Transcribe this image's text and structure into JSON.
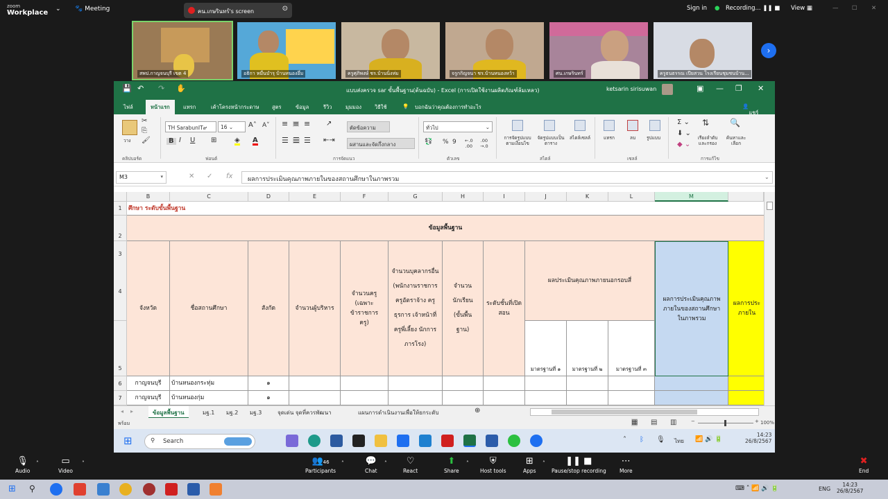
{
  "zoom": {
    "brand_small": "zoom",
    "brand": "Workplace",
    "meeting": "Meeting",
    "share_label": "คน.เกษรินทร์'s screen",
    "sign_in": "Sign in",
    "recording": "Recording...",
    "view": "View"
  },
  "participants": [
    "สพป.กาญจนบุรี เขต 4",
    "อธิกา หมื่นบำรุ บ้านหนองอึ่ม",
    "ครูศุภิพงษ์ ชร.บ้านนิ่งห่ม",
    "จรูกกิญจนา ชร.บ้านหนองหว้า",
    "ศน.เกษรินทร์",
    "ครูธนธรรณ เปียสวน โรงเรียนชุมชนบ้าน..."
  ],
  "excel": {
    "title": "แบบส่งครวจ sar ขั้นพื้นฐาน(ต้นฉบับ) - Excel (การเปิดใช้งานผลิตภัณฑ์ล้มเหลว)",
    "user": "ketsarin sirisuwan",
    "tabs": [
      "ไฟล์",
      "หน้าแรก",
      "แทรก",
      "เค้าโครงหน้ากระดาษ",
      "สูตร",
      "ข้อมูล",
      "รีวิว",
      "มุมมอง",
      "วิธีใช้",
      "บอกฉันว่าคุณต้องการทำอะไร"
    ],
    "share_btn": "แชร์",
    "ribbon": {
      "font": "TH SarabunIT๙",
      "size": "16",
      "format": "ทั่วไป",
      "wrap": "ตัดข้อความ",
      "merge": "ผสานและจัดกึ่งกลาง",
      "paste": "วาง",
      "g1": "คลิปบอร์ด",
      "g2": "ฟอนต์",
      "g3": "การจัดแนว",
      "g4": "ตัวเลข",
      "g5": "สไตล์",
      "g6": "เซลล์",
      "g7": "การแก้ไข",
      "cond": "การจัดรูปแบบตามเงื่อนไข",
      "astable": "จัดรูปแบบเป็นตาราง",
      "styles": "สไตล์เซลล์",
      "insert": "แทรก",
      "delete": "ลบ",
      "format2": "รูปแบบ",
      "sort": "เรียงลำดับและกรอง",
      "find": "ค้นหาและเลือก"
    },
    "namebox": "M3",
    "formula": "ผลการประเมินคุณภาพภายในของสถานศึกษาในภาพรวม",
    "cols": [
      "B",
      "C",
      "D",
      "E",
      "F",
      "G",
      "H",
      "I",
      "J",
      "K",
      "L",
      "M"
    ],
    "rows": [
      "1",
      "2",
      "3",
      "4",
      "5",
      "6",
      "7"
    ],
    "r1": "ศึกษา ระดับขั้นพื้นฐาน",
    "r2": "ข้อมูลพื้นฐาน",
    "h": {
      "b": "จังหวัด",
      "c": "ชื่อสถานศึกษา",
      "d": "สังกัด",
      "e": "จำนวนผู้บริหาร",
      "f": "จำนวนครู (เฉพาะข้าราชการครู)",
      "g": "จำนวนบุคลากรอื่น (พนักงานราชการ ครูอัตราจ้าง ครูธุรการ เจ้าหน้าที่ ครูพี่เลี้ยง นักการภารโรง)",
      "h2": "จำนวนนักเรียน (ขั้นพื้นฐาน)",
      "i": "ระดับชั้นที่เปิดสอน",
      "jl": "ผลประเมินคุณภาพภายนอกรอบสี่",
      "j5": "มาตรฐานที่ ๑",
      "k5": "มาตรฐานที่ ๒",
      "l5": "มาตรฐานที่ ๓",
      "m": "ผลการประเมินคุณภาพภายในของสถานศึกษาในภาพรวม",
      "n": "ผลการประ ภายใน"
    },
    "data": [
      {
        "b": "กาญจนบุรี",
        "c": "บ้านหนองกระทุ่ม",
        "d": "๑"
      },
      {
        "b": "กาญจนบุรี",
        "c": "บ้านหนองกุ่ม",
        "d": "๑"
      }
    ],
    "sheets": [
      "ข้อมูลพื้นฐาน",
      "มฐ.1",
      "มฐ.2",
      "มฐ.3",
      "จุดเด่น จุดที่ควรพัฒนา",
      "แผนการดำเนินงานเพื่อให้ยกระดับ"
    ],
    "status_left": "พร้อม",
    "zoom_pct": "100%",
    "search": "Search",
    "lang": "ไทย",
    "time": "14:23",
    "date": "26/8/2567"
  },
  "bottom": {
    "audio": "Audio",
    "video": "Video",
    "participants": "Participants",
    "count": "46",
    "chat": "Chat",
    "react": "React",
    "share": "Share",
    "host": "Host tools",
    "apps": "Apps",
    "rec": "Pause/stop recording",
    "more": "More",
    "end": "End"
  },
  "taskbar": {
    "lang": "ENG",
    "time": "14:23",
    "date": "26/8/2567"
  }
}
